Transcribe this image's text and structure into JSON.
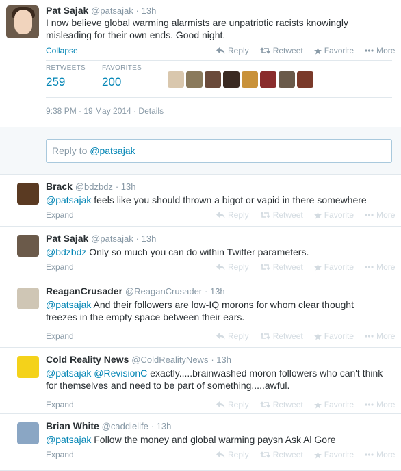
{
  "main_tweet": {
    "name": "Pat Sajak",
    "handle": "@patsajak",
    "time": "· 13h",
    "text_line1": "I now believe global warming alarmists are unpatriotic racists knowingly",
    "text_line2": "misleading for their own ends. Good night.",
    "collapse_label": "Collapse",
    "reply_label": "Reply",
    "retweet_label": "Retweet",
    "favorite_label": "Favorite",
    "more_label": "More",
    "retweets_label": "RETWEETS",
    "retweets_count": "259",
    "favorites_label": "FAVORITES",
    "favorites_count": "200",
    "timestamp": "9:38 PM - 19 May 2014",
    "details_label": "Details",
    "favoriter_avatar_colors": [
      "#d9c7ad",
      "#8a7a5c",
      "#6a4a3a",
      "#3a2a22",
      "#c9923a",
      "#8a2c2c",
      "#6a5a4a",
      "#7a3a2a"
    ]
  },
  "reply_box": {
    "prefix": "Reply to ",
    "mention": "@patsajak"
  },
  "replies": [
    {
      "name": "Brack",
      "handle": "@bdzbdz",
      "time": "· 13h",
      "mention": "@patsajak",
      "line1": " feels like you should thrown a bigot or vapid in there somewhere",
      "line2": "",
      "expand": "Expand",
      "avatar_color": "#5a3a22"
    },
    {
      "name": "Pat Sajak",
      "handle": "@patsajak",
      "time": "· 13h",
      "mention": "@bdzbdz",
      "line1": " Only so much you can do within Twitter parameters.",
      "line2": "",
      "expand": "Expand",
      "avatar_color": "#6b5a4a"
    },
    {
      "name": "ReaganCrusader",
      "handle": "@ReaganCrusader",
      "time": "· 13h",
      "mention": "@patsajak",
      "line1": " And their followers are low-IQ morons for whom clear thought",
      "line2": "freezes in the empty space between their ears.",
      "expand": "Expand",
      "avatar_color": "#cfc6b5"
    },
    {
      "name": "Cold Reality News",
      "handle": "@ColdRealityNews",
      "time": "· 13h",
      "mention": "@patsajak",
      "mention2": "@RevisionC",
      "line1": " exactly.....brainwashed moron followers who can't think",
      "line2": "for themselves and need to be part of something.....awful.",
      "expand": "Expand",
      "avatar_color": "#f4d21a"
    },
    {
      "name": "Brian White",
      "handle": "@caddielife",
      "time": "· 13h",
      "mention": "@patsajak",
      "line1": " Follow the money and global warming paysn Ask Al Gore",
      "line2": "",
      "expand": "Expand",
      "avatar_color": "#8aa6c4"
    }
  ],
  "action_labels": {
    "reply": "Reply",
    "retweet": "Retweet",
    "favorite": "Favorite",
    "more": "More"
  },
  "icons": [
    "reply-icon",
    "retweet-icon",
    "star-icon",
    "more-dots-icon"
  ]
}
